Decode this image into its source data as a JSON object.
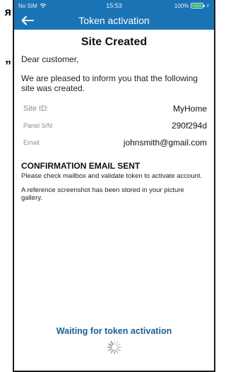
{
  "cropped_text": {
    "glyph_1": "я",
    "glyph_2": "”"
  },
  "status_bar": {
    "carrier": "No SIM",
    "time": "15:53",
    "battery_percent": "100%",
    "battery_level": 1.0
  },
  "nav": {
    "title": "Token activation",
    "back_icon": "arrow-left-icon"
  },
  "main": {
    "heading": "Site Created",
    "greeting": "Dear customer,",
    "intro": "We are pleased to inform you that the following site was created.",
    "info": [
      {
        "label": "Site ID:",
        "value": "MyHome"
      },
      {
        "label": "Panel S/N:",
        "value": "290f294d"
      },
      {
        "label": "Email:",
        "value": "johnsmith@gmail.com"
      }
    ],
    "confirmation_title": "CONFIRMATION EMAIL SENT",
    "confirmation_text": "Please check mailbox and validate token to activate account.",
    "screenshot_note": "A reference screenshot has been stored in your picture gallery.",
    "waiting_text": "Waiting for token activation"
  },
  "colors": {
    "header": "#1a73b5",
    "waiting_text": "#1e5f8e",
    "battery": "#4cd964"
  }
}
